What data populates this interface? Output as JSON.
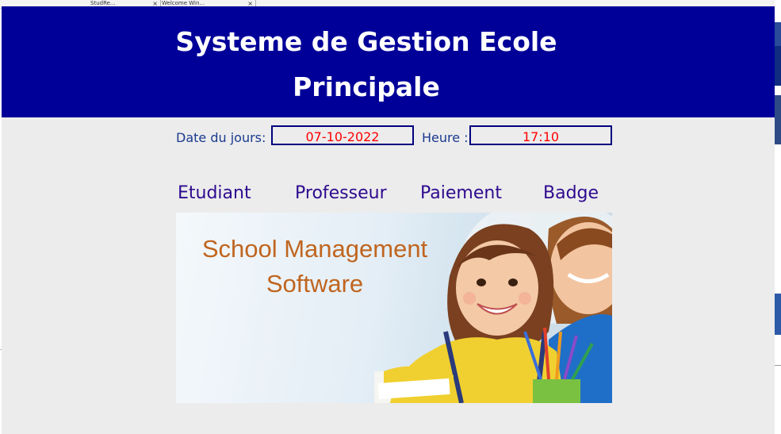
{
  "background": {
    "tabs": [
      {
        "label": "StudRe...",
        "close": "×"
      },
      {
        "label": "Welcome Win...",
        "close": "×"
      }
    ]
  },
  "app": {
    "title_line1": "Systeme de Gestion Ecole",
    "title_line2": "Principale",
    "date_label": "Date du jours:",
    "date_value": "07-10-2022",
    "time_label": "Heure :",
    "time_value": "17:10",
    "nav": [
      "Etudiant",
      "Professeur",
      "Paiement",
      "Badge"
    ],
    "banner": {
      "line1": "School Management",
      "line2": "Software"
    }
  },
  "colors": {
    "header_bg": "#000099",
    "title_text": "#ffffff",
    "label_text": "#1a3a8f",
    "field_border": "#000080",
    "field_text": "#ff0000",
    "nav_text": "#2e0a8f",
    "banner_text": "#c0651f",
    "window_bg": "#ececec"
  }
}
